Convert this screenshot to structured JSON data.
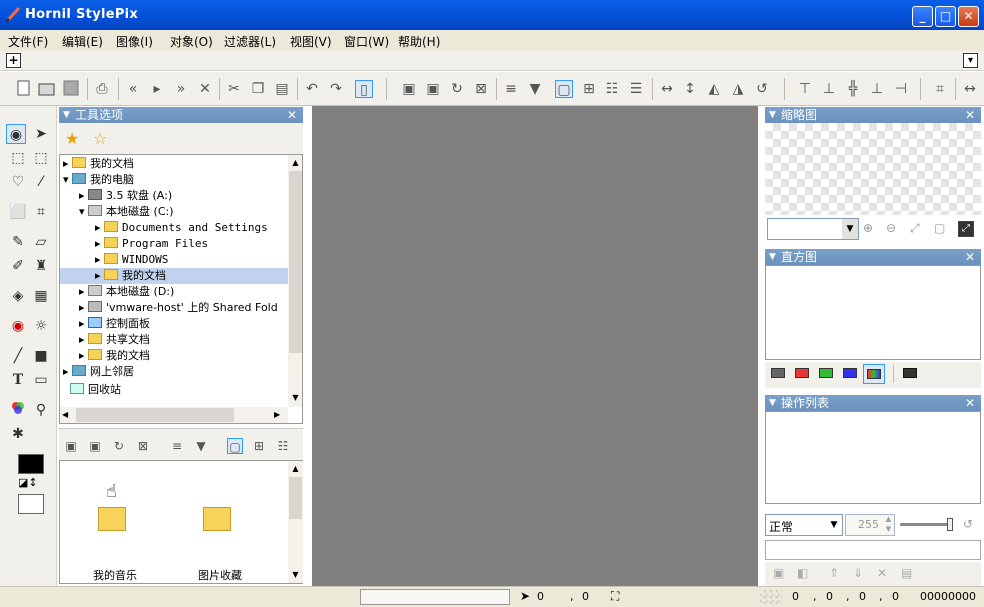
{
  "window": {
    "title": "Hornil StylePix",
    "minimize": "_",
    "maximize": "□",
    "close": "✕"
  },
  "menu": [
    "文件(F)",
    "编辑(E)",
    "图像(I)",
    "对象(O)",
    "过滤器(L)",
    "视图(V)",
    "窗口(W)",
    "帮助(H)"
  ],
  "subbar": {
    "plus": "+",
    "dropdown": "▾"
  },
  "tool_options_panel": {
    "title": "工具选项",
    "close": "✕"
  },
  "tree": [
    {
      "label": "我的文档",
      "indent": 0,
      "selected": false
    },
    {
      "label": "我的电脑",
      "indent": 0,
      "selected": false
    },
    {
      "label": "3.5 软盘 (A:)",
      "indent": 1,
      "selected": false
    },
    {
      "label": "本地磁盘 (C:)",
      "indent": 1,
      "selected": false
    },
    {
      "label": "Documents and Settings",
      "indent": 2,
      "selected": false
    },
    {
      "label": "Program Files",
      "indent": 2,
      "selected": false
    },
    {
      "label": "WINDOWS",
      "indent": 2,
      "selected": false
    },
    {
      "label": "我的文档",
      "indent": 2,
      "selected": true
    },
    {
      "label": "本地磁盘 (D:)",
      "indent": 1,
      "selected": false
    },
    {
      "label": "'vmware-host' 上的 Shared Fold",
      "indent": 1,
      "selected": false
    },
    {
      "label": "控制面板",
      "indent": 1,
      "selected": false
    },
    {
      "label": "共享文档",
      "indent": 1,
      "selected": false
    },
    {
      "label": "我的文档",
      "indent": 1,
      "selected": false
    },
    {
      "label": "网上邻居",
      "indent": 0,
      "selected": false
    },
    {
      "label": "回收站",
      "indent": 0,
      "selected": false
    }
  ],
  "file_list": [
    {
      "label": "我的音乐"
    },
    {
      "label": "图片收藏"
    }
  ],
  "thumbnail_panel": {
    "title": "缩略图",
    "close": "✕"
  },
  "histogram_panel": {
    "title": "直方图",
    "close": "✕"
  },
  "operations_panel": {
    "title": "操作列表",
    "close": "✕"
  },
  "layer_controls": {
    "blend_mode": "正常",
    "opacity": "255"
  },
  "status": {
    "pos_x": "0",
    "pos_y": "0",
    "c1": "0",
    "c2": "0",
    "c3": "0",
    "c4": "0",
    "hex": "00000000",
    "sep": ","
  },
  "colors": {
    "accent": "#0a5fe6",
    "panel_header": "#7aa0c8",
    "canvas_bg": "#808080",
    "selection": "#c1d2ee"
  }
}
